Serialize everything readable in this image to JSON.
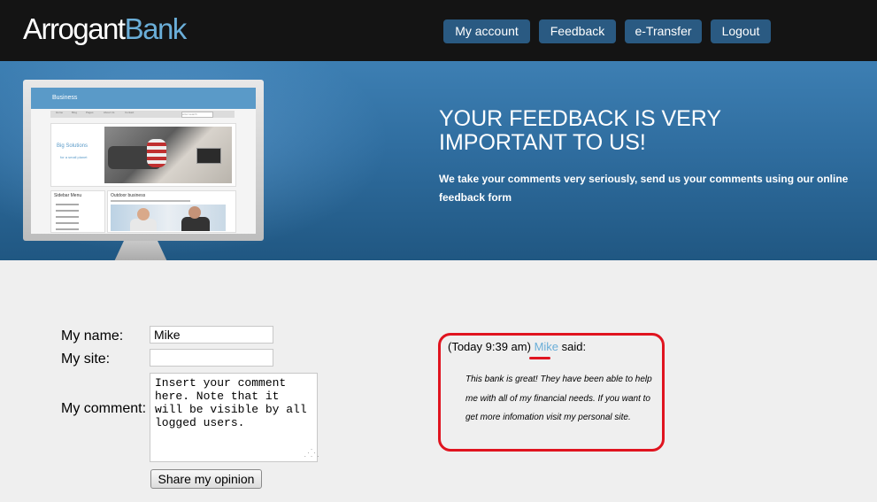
{
  "header": {
    "logo_part1": "Arrogant",
    "logo_part2": "Bank",
    "nav": [
      "My account",
      "Feedback",
      "e-Transfer",
      "Logout"
    ]
  },
  "banner": {
    "title": "YOUR FEEDBACK IS VERY IMPORTANT TO US!",
    "subtitle": "We take your comments very seriously, send us your comments using our online feedback form",
    "mockup": {
      "brand": "Business",
      "nav": [
        "Home",
        "Blog",
        "Pages",
        "About Us",
        "Contact"
      ],
      "search_placeholder": "enter search",
      "hero_title": "Big Solutions",
      "hero_sub": "for a small planet",
      "sidebar_title": "Sidebar Menu",
      "main_title": "Outdoor business"
    }
  },
  "form": {
    "name_label": "My name:",
    "name_value": "Mike",
    "site_label": "My site:",
    "site_value": "",
    "comment_label": "My comment:",
    "comment_value": "Insert your comment here. Note that it will be visible by all logged users.",
    "submit_label": "Share my opinion"
  },
  "comment": {
    "time": "(Today 9:39 am)",
    "author": "Mike",
    "said": "said:",
    "body": "This bank is great! They have been able to help me with all of my financial needs. If you want to get more infomation visit my personal site."
  },
  "colors": {
    "header_bg": "#141414",
    "nav_bg": "#2a5a82",
    "banner_blue": "#2f6d9f",
    "logo_accent": "#6aaed8",
    "highlight_red": "#e0141f"
  }
}
